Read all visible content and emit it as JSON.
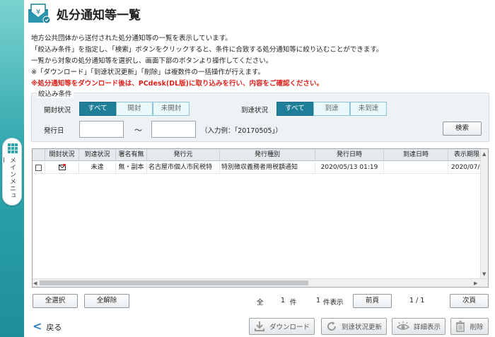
{
  "page": {
    "title": "処分通知等一覧",
    "description": [
      "地方公共団体から送付された処分通知等の一覧を表示しています。",
      "「絞込み条件」を指定し、「検索」ボタンをクリックすると、条件に合致する処分通知等に絞り込むことができます。",
      "一覧から対象の処分通知等を選択し、画面下部のボタンより操作してください。",
      "※「ダウンロード」「到達状況更新」「削除」は複数件の一括操作が行えます。"
    ],
    "warning": "※処分通知等をダウンロード後は、PCdesk(DL版)に取り込みを行い、内容をご確認ください。"
  },
  "side_menu": {
    "label": "メインメニュー"
  },
  "filter": {
    "caption": "絞込み条件",
    "open_status": {
      "label": "開封状況",
      "options": [
        "すべて",
        "開封",
        "未開封"
      ],
      "selected": "すべて"
    },
    "arrival_status": {
      "label": "到達状況",
      "options": [
        "すべて",
        "到達",
        "未到達"
      ],
      "selected": "すべて"
    },
    "issue_date": {
      "label": "発行日",
      "from_value": "",
      "to_value": "",
      "separator": "～",
      "hint": "（入力例：「20170505」）"
    },
    "search_label": "検索"
  },
  "table": {
    "headers": [
      "",
      "開封状況",
      "到達状況",
      "署名有無",
      "発行元",
      "発行種別",
      "発行日時",
      "到達日時",
      "表示期限"
    ],
    "rows": [
      {
        "checked": false,
        "open_icon": "unopened-mail-icon",
        "arrival": "未達",
        "signature": "無・副本",
        "issuer": "名古屋市個人市民税特",
        "type": "特別徴収義務者用税額通知",
        "issued_at": "2020/05/13 01:19",
        "arrived_at": "",
        "display_limit": "2020/07/"
      }
    ]
  },
  "selection": {
    "select_all": "全選択",
    "deselect_all": "全解除"
  },
  "pagination": {
    "total_prefix": "全",
    "total": "1",
    "total_unit": "件",
    "shown": "1",
    "shown_unit": "件表示",
    "prev": "前頁",
    "page_text": "1 / 1",
    "next": "次頁"
  },
  "footer": {
    "back": "戻る",
    "download": "ダウンロード",
    "update_status": "到達状況更新",
    "details": "詳細表示",
    "delete": "削除"
  },
  "colors": {
    "rail": "#2fa6ad",
    "segment_active": "#1f7f99",
    "warning": "#e0201b"
  }
}
